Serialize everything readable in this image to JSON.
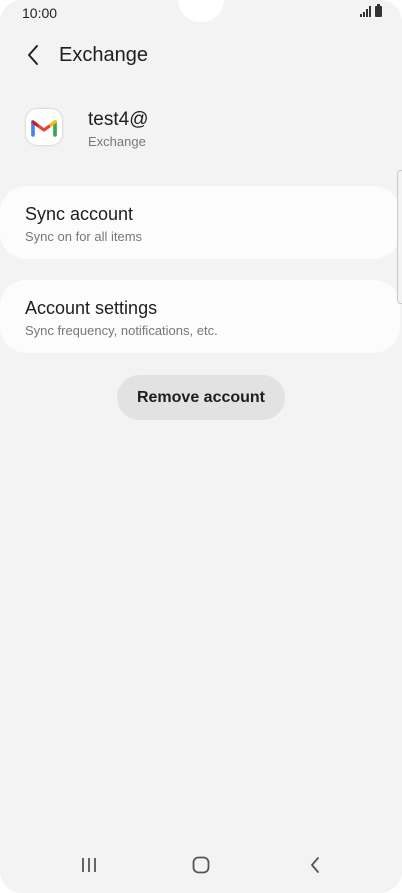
{
  "status_bar": {
    "time": "10:00"
  },
  "header": {
    "title": "Exchange",
    "back_icon": "chevron-left-icon"
  },
  "account": {
    "name": "test4@",
    "type": "Exchange",
    "logo_icon": "gmail-logo-icon"
  },
  "cards": [
    {
      "title": "Sync account",
      "subtitle": "Sync on for all items"
    },
    {
      "title": "Account settings",
      "subtitle": "Sync frequency, notifications, etc."
    }
  ],
  "remove_label": "Remove account",
  "nav": {
    "recent_icon": "recent-apps-icon",
    "home_icon": "home-icon",
    "back_icon": "back-icon"
  },
  "colors": {
    "background": "#f3f3f3",
    "card": "#fcfcfc",
    "button": "#e2e2e2",
    "gmail_red": "#ea4335",
    "gmail_blue": "#4285f4",
    "gmail_green": "#34a853",
    "gmail_yellow": "#fbbc04"
  }
}
